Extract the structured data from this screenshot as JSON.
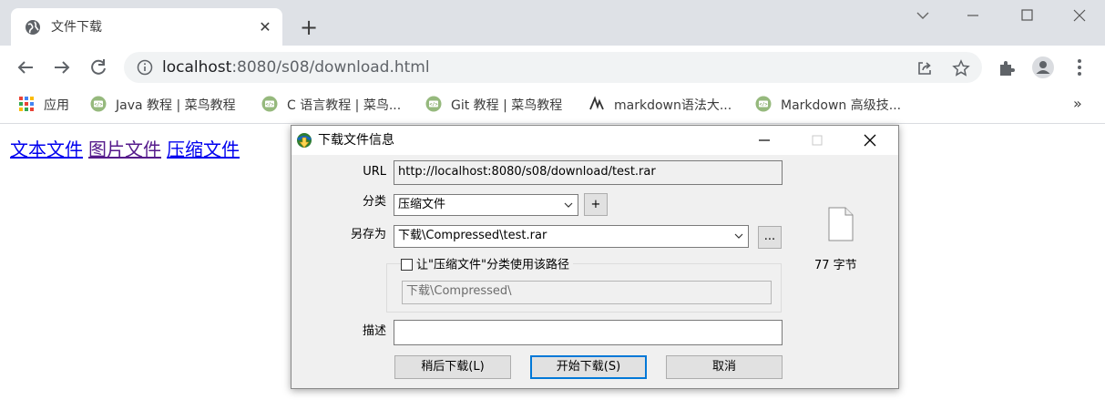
{
  "browser": {
    "tab": {
      "title": "文件下载",
      "close": "✕",
      "favicon": "globe-icon"
    },
    "new_tab": "+",
    "address": {
      "host": "localhost",
      "path": ":8080/s08/download.html"
    },
    "bookmarks": [
      {
        "label": "应用",
        "icon": "apps-grid-icon"
      },
      {
        "label": "Java 教程 | 菜鸟教程",
        "icon": "runoob-icon"
      },
      {
        "label": "C 语言教程 | 菜鸟...",
        "icon": "runoob-icon"
      },
      {
        "label": "Git 教程 | 菜鸟教程",
        "icon": "runoob-icon"
      },
      {
        "label": "markdown语法大...",
        "icon": "markdown-icon"
      },
      {
        "label": "Markdown 高级技...",
        "icon": "runoob-icon"
      }
    ],
    "bookmarks_more": "»"
  },
  "page": {
    "links": [
      "文本文件",
      "图片文件",
      "压缩文件"
    ]
  },
  "dialog": {
    "title": "下载文件信息",
    "url_label": "URL",
    "url_value": "http://localhost:8080/s08/download/test.rar",
    "category_label": "分类",
    "category_value": "压缩文件",
    "add_category": "+",
    "saveas_label": "另存为",
    "saveas_value": "下载\\Compressed\\test.rar",
    "browse": "...",
    "checkbox_label": "让\"压缩文件\"分类使用该路径",
    "path_value": "下载\\Compressed\\",
    "desc_label": "描述",
    "desc_value": "",
    "size_text": "77  字节",
    "buttons": {
      "later": "稍后下载(L)",
      "start": "开始下载(S)",
      "cancel": "取消"
    }
  },
  "colors": {
    "tab_strip": "#dee1e6",
    "link": "#0000ee",
    "link_visited": "#551a8b",
    "default_button_border": "#0078d7"
  }
}
